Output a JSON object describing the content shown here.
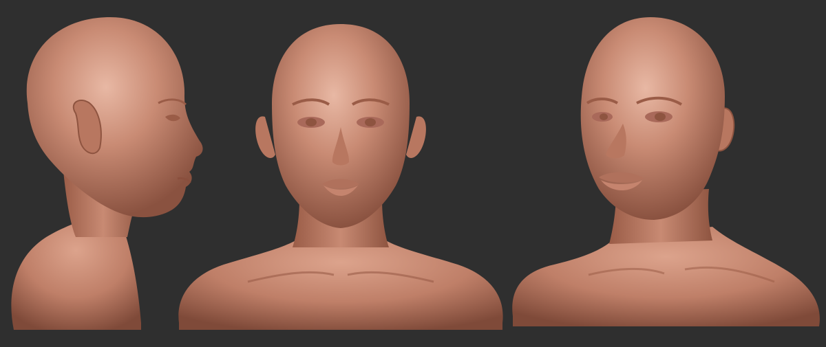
{
  "scene": {
    "background_color": "#2f2f2f",
    "skin_base_color": "#c88a73",
    "skin_shadow_color": "#8e5440",
    "skin_highlight_color": "#e8b8a4"
  },
  "views": [
    {
      "id": "side",
      "description_name": "side-profile-bust"
    },
    {
      "id": "front",
      "description_name": "front-view-bust"
    },
    {
      "id": "three-quarter",
      "description_name": "three-quarter-bust"
    }
  ]
}
